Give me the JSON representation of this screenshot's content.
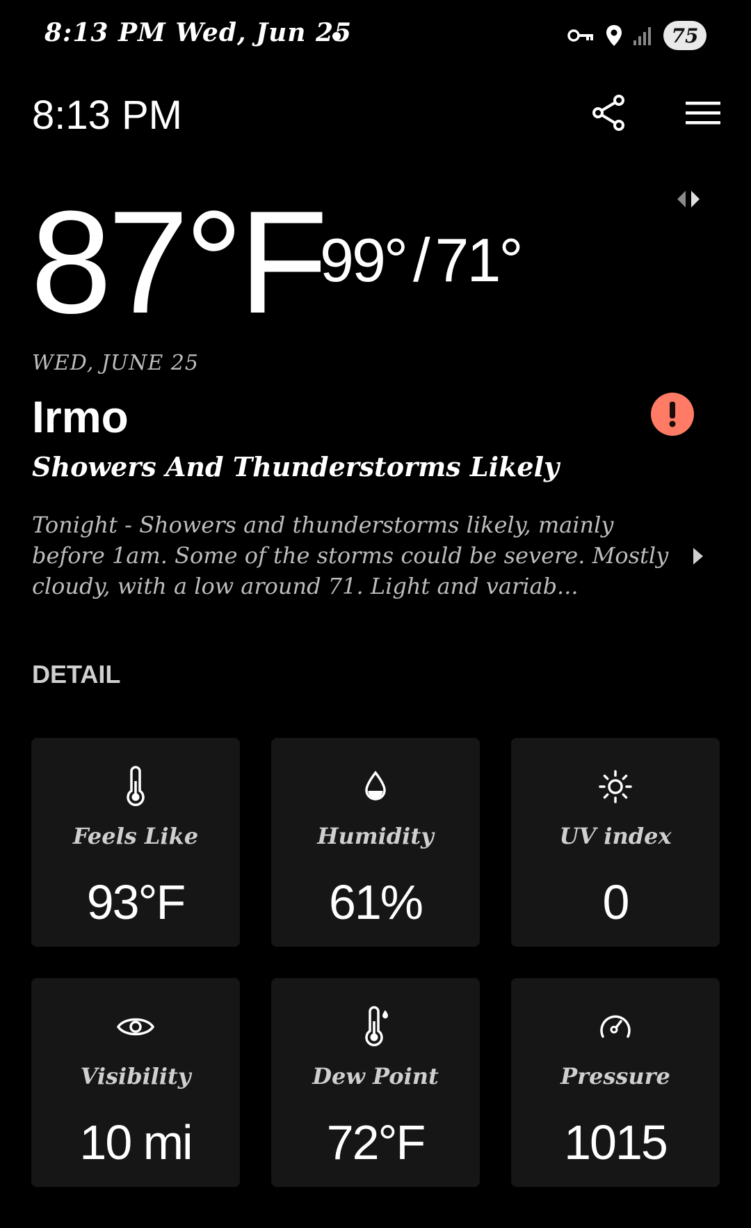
{
  "status_bar": {
    "time_date": "8:13 PM  Wed, Jun 25",
    "battery": "75",
    "icons": [
      "vpn-key-icon",
      "location-icon",
      "signal-icon",
      "battery-icon"
    ]
  },
  "top_bar": {
    "time": "8:13 PM",
    "share_icon": "share-icon",
    "menu_icon": "hamburger-menu-icon"
  },
  "current": {
    "temp": "87°F",
    "high": "99°",
    "low": "71°",
    "slash": "/",
    "date": "WED, JUNE 25",
    "city": "Irmo",
    "condition": "Showers And Thunderstorms Likely",
    "forecast": "Tonight - Showers and thunderstorms likely, mainly before 1am. Some of the storms could be severe. Mostly cloudy, with a low around 71. Light and variab...",
    "alert_color": "#ff7b66"
  },
  "detail": {
    "title": "DETAIL",
    "tiles": [
      {
        "icon": "thermometer-icon",
        "label": "Feels Like",
        "value": "93°F"
      },
      {
        "icon": "droplet-icon",
        "label": "Humidity",
        "value": "61%"
      },
      {
        "icon": "sun-icon",
        "label": "UV index",
        "value": "0"
      },
      {
        "icon": "eye-icon",
        "label": "Visibility",
        "value": "10 mi"
      },
      {
        "icon": "dew-point-thermometer-icon",
        "label": "Dew Point",
        "value": "72°F"
      },
      {
        "icon": "gauge-icon",
        "label": "Pressure",
        "value": "1015"
      }
    ]
  },
  "colors": {
    "background": "#000000",
    "tile_background": "#161616",
    "secondary_text": "#bdbdbd"
  }
}
